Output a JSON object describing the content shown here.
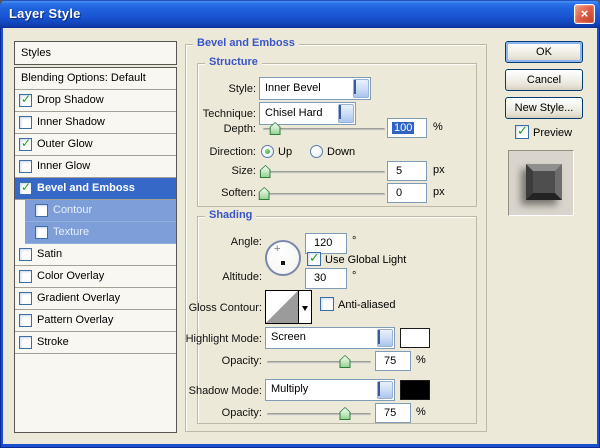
{
  "window": {
    "title": "Layer Style"
  },
  "icons": {
    "close": "×",
    "check": "✓"
  },
  "sidebar": {
    "header": "Styles",
    "items": [
      {
        "label": "Blending Options: Default"
      },
      {
        "label": "Drop Shadow",
        "checked": true
      },
      {
        "label": "Inner Shadow",
        "checked": false
      },
      {
        "label": "Outer Glow",
        "checked": true
      },
      {
        "label": "Inner Glow",
        "checked": false
      },
      {
        "label": "Bevel and Emboss",
        "checked": true,
        "selected": true
      },
      {
        "label": "Contour",
        "checked": false,
        "sub": true
      },
      {
        "label": "Texture",
        "checked": false,
        "sub": true
      },
      {
        "label": "Satin",
        "checked": false
      },
      {
        "label": "Color Overlay",
        "checked": false
      },
      {
        "label": "Gradient Overlay",
        "checked": false
      },
      {
        "label": "Pattern Overlay",
        "checked": false
      },
      {
        "label": "Stroke",
        "checked": false
      }
    ]
  },
  "panel": {
    "title": "Bevel and Emboss",
    "structure": {
      "title": "Structure",
      "style": {
        "label": "Style:",
        "value": "Inner Bevel"
      },
      "technique": {
        "label": "Technique:",
        "value": "Chisel Hard"
      },
      "depth": {
        "label": "Depth:",
        "value": "100",
        "unit": "%",
        "slider_percent": 10,
        "value_selected": true
      },
      "direction": {
        "label": "Direction:",
        "up_label": "Up",
        "down_label": "Down",
        "up_selected": true,
        "down_selected": false
      },
      "size": {
        "label": "Size:",
        "value": "5",
        "unit": "px",
        "slider_percent": 2
      },
      "soften": {
        "label": "Soften:",
        "value": "0",
        "unit": "px",
        "slider_percent": 1
      }
    },
    "shading": {
      "title": "Shading",
      "angle": {
        "label": "Angle:",
        "value": "120",
        "unit": "°"
      },
      "use_global_light": {
        "label": "Use Global Light",
        "checked": true
      },
      "altitude": {
        "label": "Altitude:",
        "value": "30",
        "unit": "°"
      },
      "gloss_contour": {
        "label": "Gloss Contour:"
      },
      "anti_aliased": {
        "label": "Anti-aliased",
        "checked": false
      },
      "highlight_mode": {
        "label": "Highlight Mode:",
        "value": "Screen",
        "color": "#ffffff"
      },
      "highlight_opacity": {
        "label": "Opacity:",
        "value": "75",
        "unit": "%",
        "slider_percent": 75
      },
      "shadow_mode": {
        "label": "Shadow Mode:",
        "value": "Multiply",
        "color": "#000000"
      },
      "shadow_opacity": {
        "label": "Opacity:",
        "value": "75",
        "unit": "%",
        "slider_percent": 75
      }
    }
  },
  "actions": {
    "ok": "OK",
    "cancel": "Cancel",
    "new_style": "New Style...",
    "preview": {
      "label": "Preview",
      "checked": true
    }
  },
  "colors": {
    "titlebar_blue": "#1b57d5",
    "selected_row_blue": "#3668c8",
    "sub_row_blue": "#7d9ed8",
    "check_green": "#17a317",
    "group_title_blue": "#3a55c5",
    "highlight_swatch": "#ffffff",
    "shadow_swatch": "#000000"
  }
}
